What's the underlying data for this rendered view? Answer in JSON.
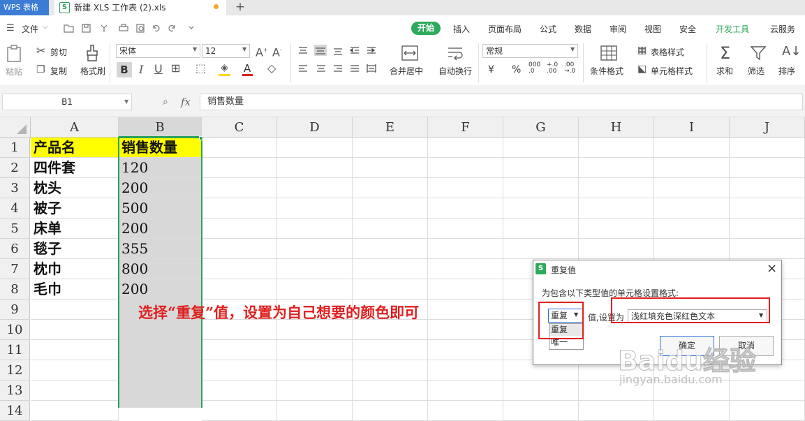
{
  "tabs": {
    "app": "WPS 表格",
    "file_icon": "S",
    "file": "新建 XLS 工作表 (2).xls",
    "add": "+"
  },
  "menu": {
    "file": "文件",
    "items": [
      "开始",
      "插入",
      "页面布局",
      "公式",
      "数据",
      "审阅",
      "视图",
      "安全",
      "开发工具",
      "云服务"
    ]
  },
  "ribbon": {
    "paste": "粘贴",
    "cut": "剪切",
    "copy": "复制",
    "format_painter": "格式刷",
    "font_name": "宋体",
    "font_size": "12",
    "merge_center": "合并居中",
    "wrap_text": "自动换行",
    "number_format": "常规",
    "conditional_format": "条件格式",
    "table_style": "表格样式",
    "cell_style": "单元格样式",
    "sum": "求和",
    "filter": "筛选",
    "sort": "排序"
  },
  "formula_bar": {
    "cell_ref": "B1",
    "fx": "fx",
    "content": "销售数量"
  },
  "grid": {
    "columns": [
      "A",
      "B",
      "C",
      "D",
      "E",
      "F",
      "G",
      "H",
      "I",
      "J"
    ],
    "rows": [
      "1",
      "2",
      "3",
      "4",
      "5",
      "6",
      "7",
      "8",
      "9",
      "10",
      "11",
      "12",
      "13",
      "14"
    ],
    "data": [
      [
        "产品名",
        "销售数量"
      ],
      [
        "四件套",
        "120"
      ],
      [
        "枕头",
        "200"
      ],
      [
        "被子",
        "500"
      ],
      [
        "床单",
        "200"
      ],
      [
        "毯子",
        "355"
      ],
      [
        "枕巾",
        "800"
      ],
      [
        "毛巾",
        "200"
      ]
    ]
  },
  "annotation": "选择“重复”值，设置为自己想要的颜色即可",
  "dialog": {
    "icon": "S",
    "title": "重复值",
    "close": "×",
    "prompt": "为包含以下类型值的单元格设置格式:",
    "type_value": "重复",
    "type_options": [
      "重复",
      "唯一"
    ],
    "set_as_label": "值,设置为",
    "format_value": "浅红填充色深红色文本",
    "ok": "确定",
    "cancel": "取消"
  },
  "watermark": {
    "logo": "Baidu经验",
    "url": "jingyan.baidu.com"
  },
  "colors": {
    "header_fill": "#ffff00",
    "selection": "#d8d8d8",
    "selection_border": "#2aa05a",
    "accent": "#2eaa5c",
    "annotation": "#e02020",
    "highlight_box": "#e02020"
  }
}
